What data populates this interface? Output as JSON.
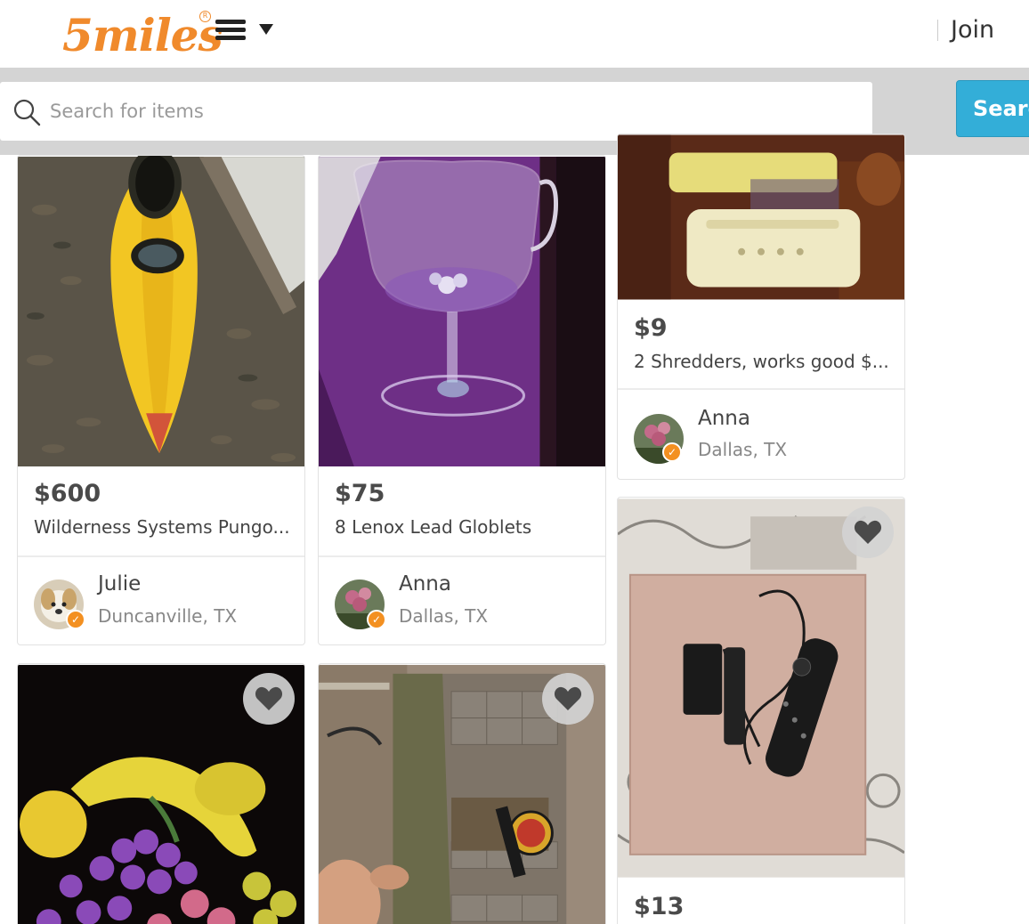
{
  "header": {
    "logo_text": "5miles",
    "logo_reg": "R",
    "join_label": "Join"
  },
  "search": {
    "placeholder": "Search for items",
    "button_label": "Search"
  },
  "listings": [
    {
      "price": "$600",
      "title": "Wilderness Systems Pungo...",
      "seller": "Julie",
      "location": "Duncanville, TX",
      "verified": true,
      "photo": "yellow kayak on leaves"
    },
    {
      "price": "$75",
      "title": "8 Lenox Lead Globlets",
      "seller": "Anna",
      "location": "Dallas, TX",
      "verified": true,
      "photo": "wine glass on purple"
    },
    {
      "price": "$9",
      "title": "2 Shredders, works good $...",
      "seller": "Anna",
      "location": "Dallas, TX",
      "verified": true,
      "photo": "two shredders"
    },
    {
      "price": "",
      "title": "",
      "seller": "",
      "location": "",
      "photo": "glitter fruit"
    },
    {
      "price": "",
      "title": "",
      "seller": "",
      "location": "",
      "photo": "jurassic park box"
    },
    {
      "price": "$13",
      "title": "",
      "seller": "",
      "location": "",
      "photo": "fire tv stick"
    }
  ],
  "icons": {
    "search": "search-icon",
    "menu": "hamburger-menu-icon",
    "caret": "caret-down-icon",
    "heart": "heart-icon",
    "verified": "verified-check-icon"
  },
  "colors": {
    "brand_orange": "#f08a2c",
    "search_button": "#33aed8",
    "search_band": "#d4d4d4",
    "badge_orange": "#f39021"
  }
}
